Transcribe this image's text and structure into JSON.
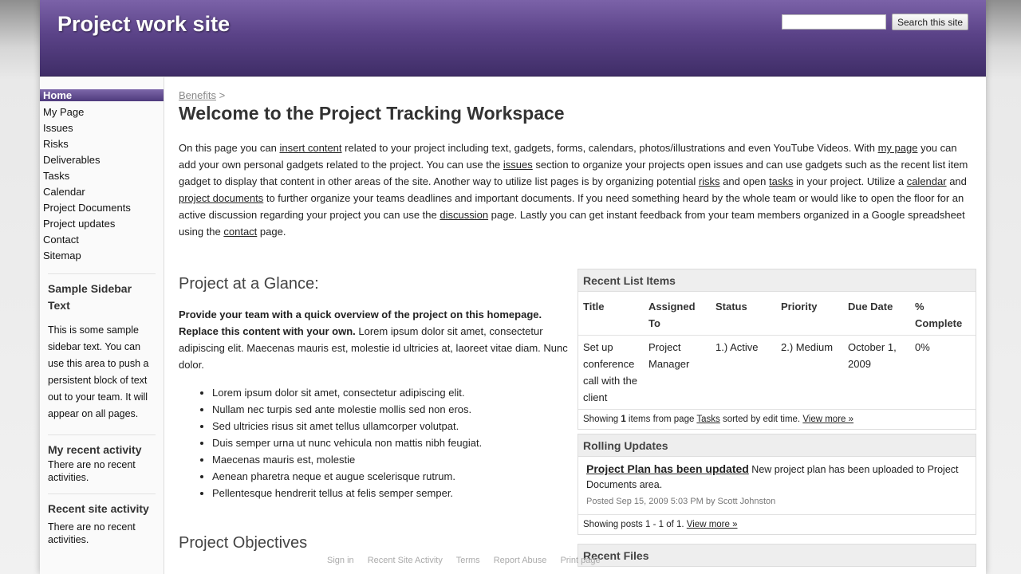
{
  "header": {
    "site_title": "Project work site",
    "search_placeholder": "",
    "search_button": "Search this site"
  },
  "sidebar": {
    "nav": [
      {
        "label": "Home"
      },
      {
        "label": "My Page"
      },
      {
        "label": "Issues"
      },
      {
        "label": "Risks"
      },
      {
        "label": "Deliverables"
      },
      {
        "label": "Tasks"
      },
      {
        "label": "Calendar"
      },
      {
        "label": "Project Documents"
      },
      {
        "label": "Project updates"
      },
      {
        "label": "Contact"
      },
      {
        "label": "Sitemap"
      }
    ],
    "box1": {
      "title": "Sample Sidebar Text",
      "text": "This is some sample sidebar text. You can use this area to push a persistent block of text out to your team. It will appear on all pages."
    },
    "box2": {
      "title": "My recent activity",
      "text": "There are no recent activities."
    },
    "box3": {
      "title": "Recent site activity",
      "text": "There are no recent activities."
    }
  },
  "main": {
    "breadcrumb": "Benefits",
    "breadcrumb_sep": ">",
    "title": "Welcome to the Project Tracking Workspace",
    "intro": {
      "t1": "On this page you can ",
      "l1": "insert content",
      "t2": " related to your project including text, gadgets, forms, calendars, photos/illustrations and even YouTube Videos. With ",
      "l2": "my page",
      "t3": " you can add your own personal gadgets related to the project. You can use the ",
      "l3": "issues",
      "t4": " section to organize your projects open issues and can use gadgets such as the recent list item gadget to display that content in other areas of the site. Another way to utilize list pages is by organizing potential ",
      "l4": "risks",
      "t5": " and open ",
      "l5": "tasks",
      "t6": " in your project. Utilize a ",
      "l6": "calendar",
      "t7": " and ",
      "l7": "project documents",
      "t8": " to further organize your teams deadlines and important documents. If you need something heard by the whole team or would like to open the floor for an active discussion regarding your project you can use the ",
      "l8": "discussion",
      "t9": " page. Lastly you can get instant feedback from your team members organized in a Google spreadsheet using the ",
      "l9": "contact",
      "t10": " page."
    },
    "glance": {
      "heading": "Project at a Glance:",
      "bold": "Provide your team with a quick overview of the project on this homepage. Replace this content with your own.",
      "rest": " Lorem ipsum dolor sit amet, consectetur adipiscing elit. Maecenas mauris est, molestie id ultricies at, laoreet vitae diam. Nunc dolor.",
      "bullets": [
        "Lorem ipsum dolor sit amet, consectetur adipiscing elit.",
        "Nullam nec turpis sed ante molestie mollis sed non eros.",
        "Sed ultricies risus sit amet tellus ullamcorper volutpat.",
        "Duis semper urna ut nunc vehicula non mattis nibh feugiat.",
        "Maecenas mauris est, molestie",
        "Aenean pharetra neque et augue scelerisque rutrum.",
        "Pellentesque hendrerit tellus at felis semper semper."
      ]
    },
    "objectives": {
      "heading": "Project Objectives"
    }
  },
  "recent_list": {
    "title": "Recent List Items",
    "columns": [
      "Title",
      "Assigned To",
      "Status",
      "Priority",
      "Due Date",
      "% Complete"
    ],
    "rows": [
      [
        "Set up conference call with the client",
        "Project Manager",
        "1.) Active",
        "2.) Medium",
        "October 1, 2009",
        "0%"
      ]
    ],
    "foot_pre": "Showing ",
    "foot_count": "1",
    "foot_mid": " items from page ",
    "foot_link": "Tasks",
    "foot_post": " sorted by edit time. ",
    "view_more": "View more »"
  },
  "rolling": {
    "title": "Rolling Updates",
    "item_title": "Project Plan has been updated",
    "item_body": " New project plan has been uploaded to Project Documents area.",
    "item_meta": "Posted Sep 15, 2009 5:03 PM by Scott Johnston",
    "foot": "Showing posts 1 - 1 of 1.",
    "view_more": "View more »"
  },
  "recent_files": {
    "title": "Recent Files"
  },
  "footer": {
    "links": [
      "Sign in",
      "Recent Site Activity",
      "Terms",
      "Report Abuse",
      "Print page"
    ]
  }
}
